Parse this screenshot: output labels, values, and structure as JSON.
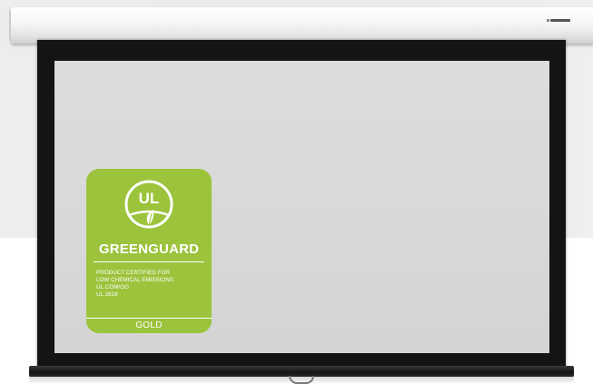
{
  "badge": {
    "emblem_text": "UL",
    "title": "GREENGUARD",
    "lines": [
      "PRODUCT CERTIFIED FOR",
      "LOW CHEMICAL EMISSIONS",
      "UL.COM/GG",
      "UL 2818"
    ],
    "level": "GOLD"
  },
  "colors": {
    "badge_green": "#9bc33c",
    "screen_surface": "#d9d9d9",
    "frame_black": "#141414",
    "housing_white": "#f6f6f6"
  }
}
